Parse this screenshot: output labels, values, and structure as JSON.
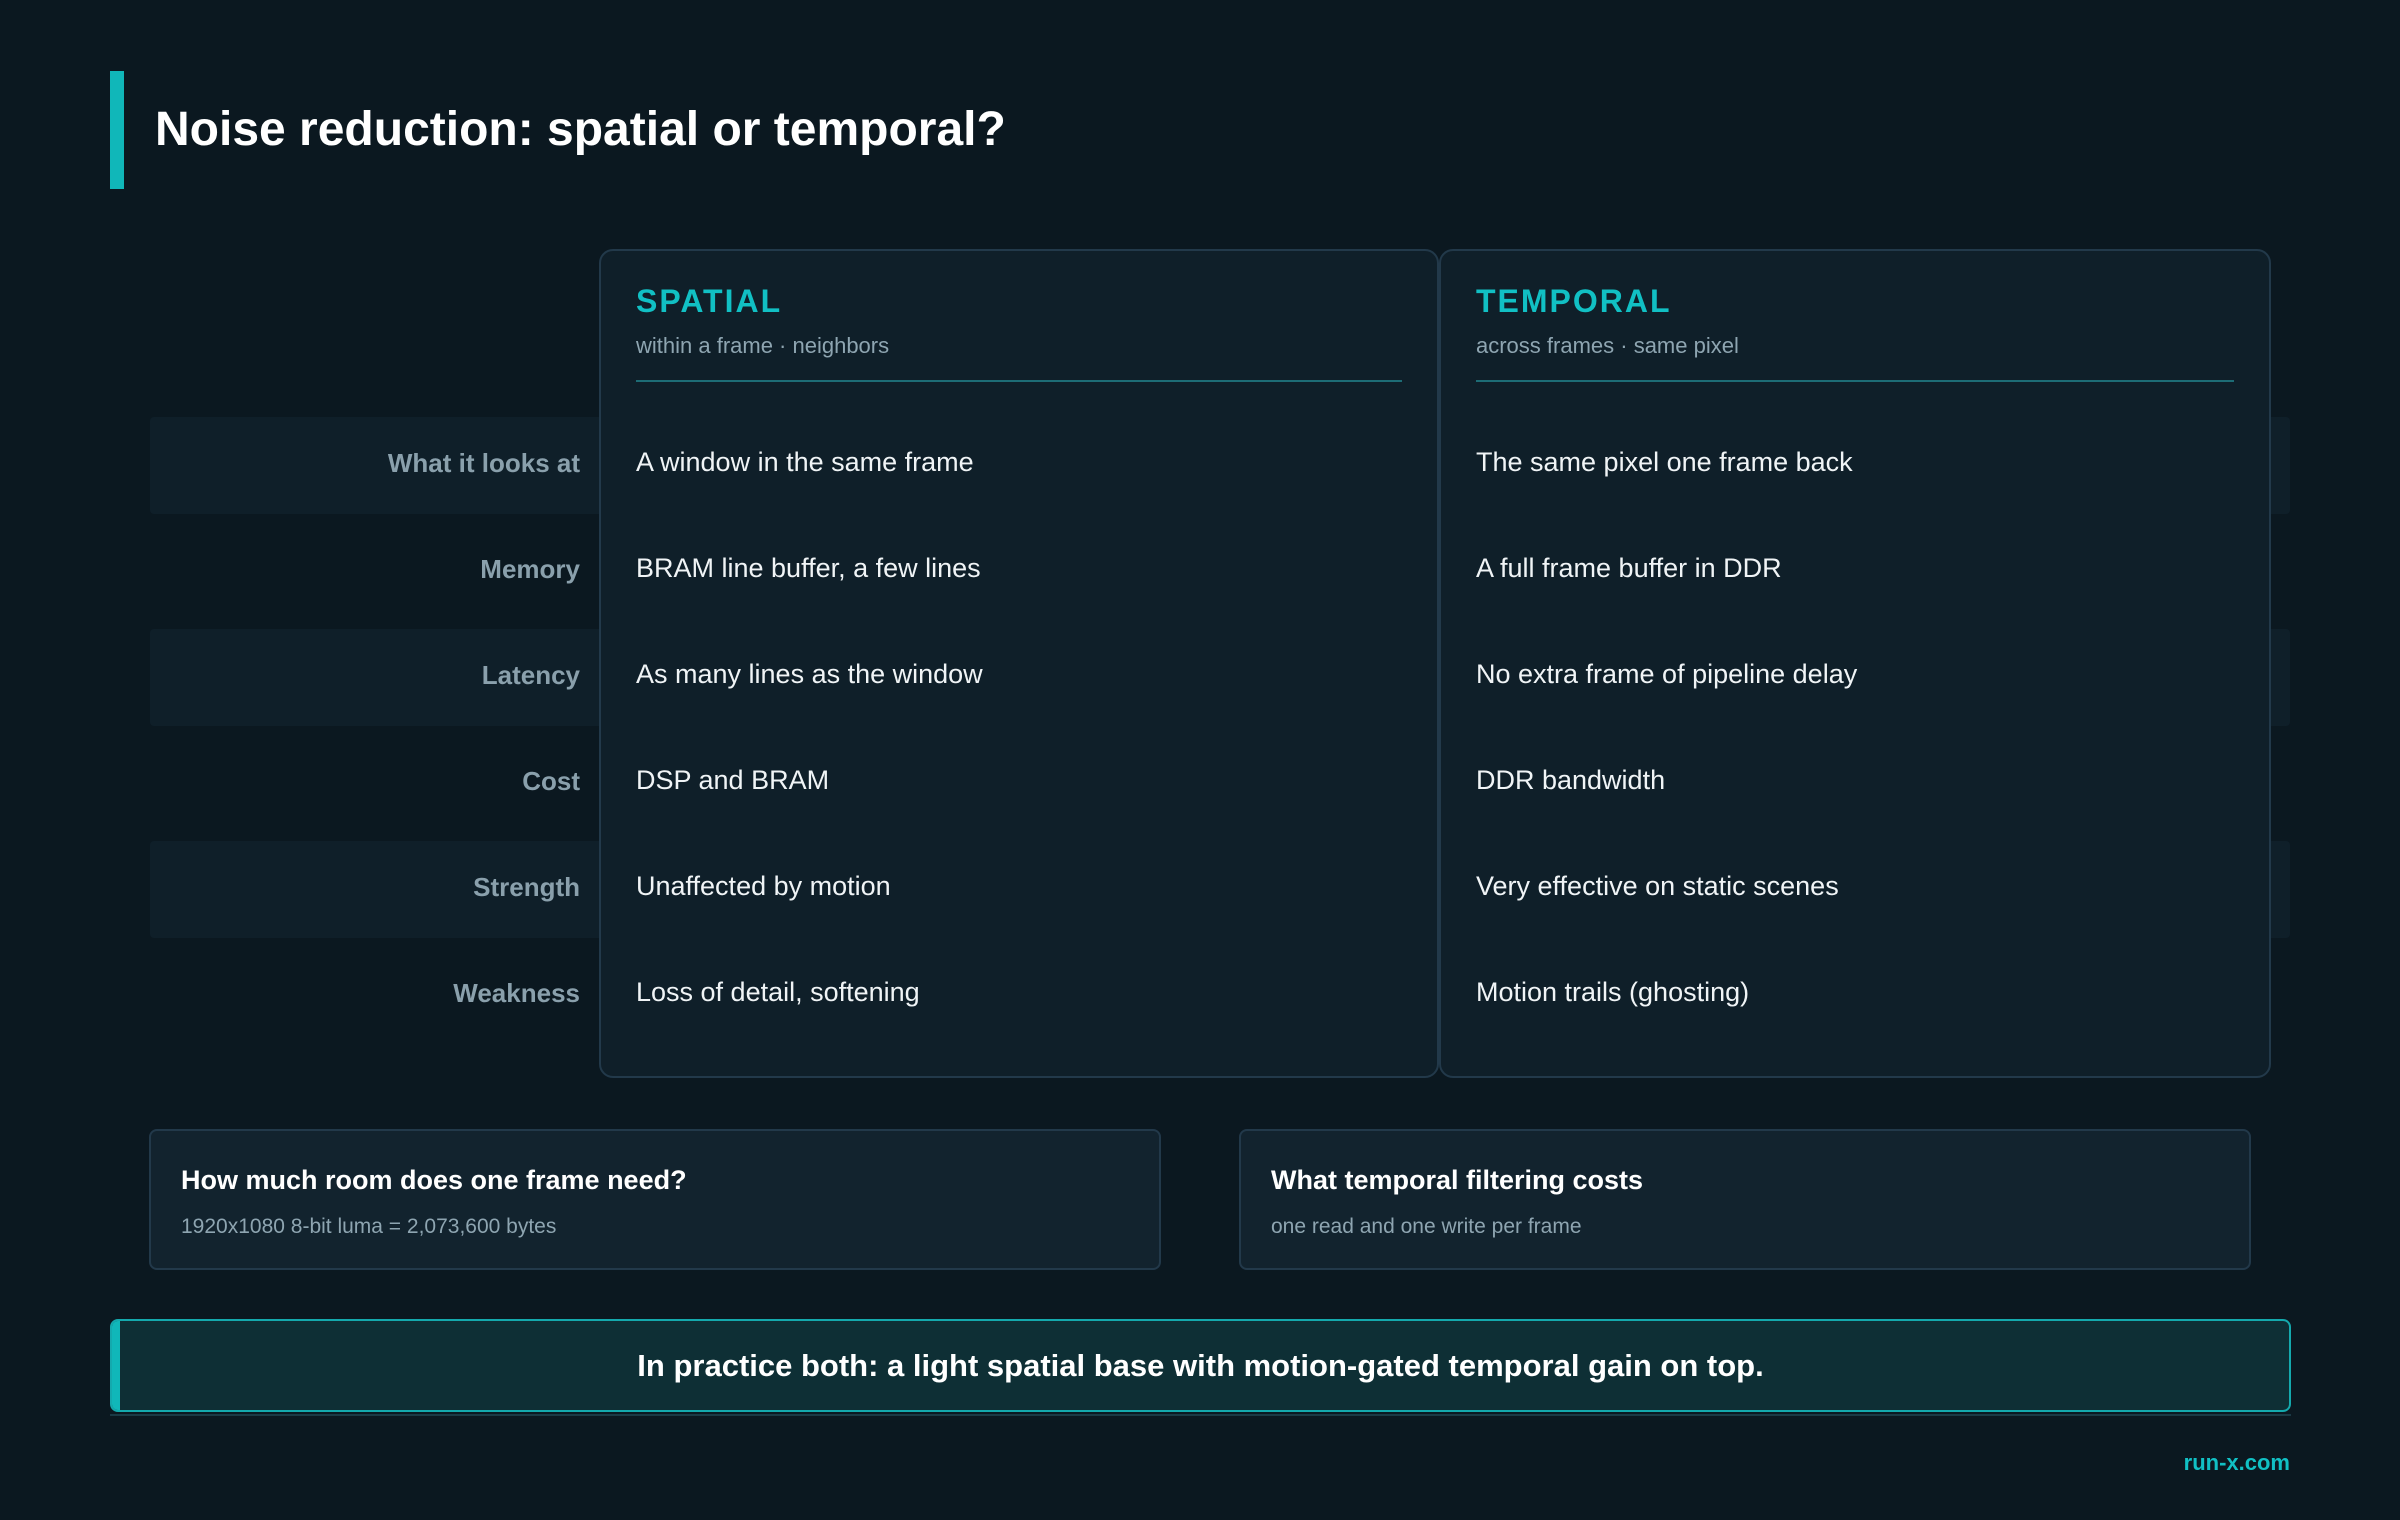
{
  "title": "Noise reduction: spatial or temporal?",
  "columns": {
    "spatial": {
      "title": "SPATIAL",
      "subtitle": "within a frame · neighbors"
    },
    "temporal": {
      "title": "TEMPORAL",
      "subtitle": "across frames · same pixel"
    }
  },
  "rows": [
    {
      "label": "What it looks at",
      "spatial": "A window in the same frame",
      "temporal": "The same pixel one frame back"
    },
    {
      "label": "Memory",
      "spatial": "BRAM line buffer, a few lines",
      "temporal": "A full frame buffer in DDR"
    },
    {
      "label": "Latency",
      "spatial": "As many lines as the window",
      "temporal": "No extra frame of pipeline delay"
    },
    {
      "label": "Cost",
      "spatial": "DSP and BRAM",
      "temporal": "DDR bandwidth"
    },
    {
      "label": "Strength",
      "spatial": "Unaffected by motion",
      "temporal": "Very effective on static scenes"
    },
    {
      "label": "Weakness",
      "spatial": "Loss of detail, softening",
      "temporal": "Motion trails (ghosting)"
    }
  ],
  "cards": [
    {
      "title": "How much room does one frame need?",
      "text": "1920x1080 8-bit luma = 2,073,600 bytes"
    },
    {
      "title": "What temporal filtering costs",
      "text": "one read and one write per frame"
    }
  ],
  "callout": "In practice both: a light spatial base with motion-gated temporal gain on top.",
  "brand": "run-x.com",
  "colors": {
    "accent": "#10b7b9",
    "background": "#0b1820",
    "panel": "#0f1f29"
  }
}
